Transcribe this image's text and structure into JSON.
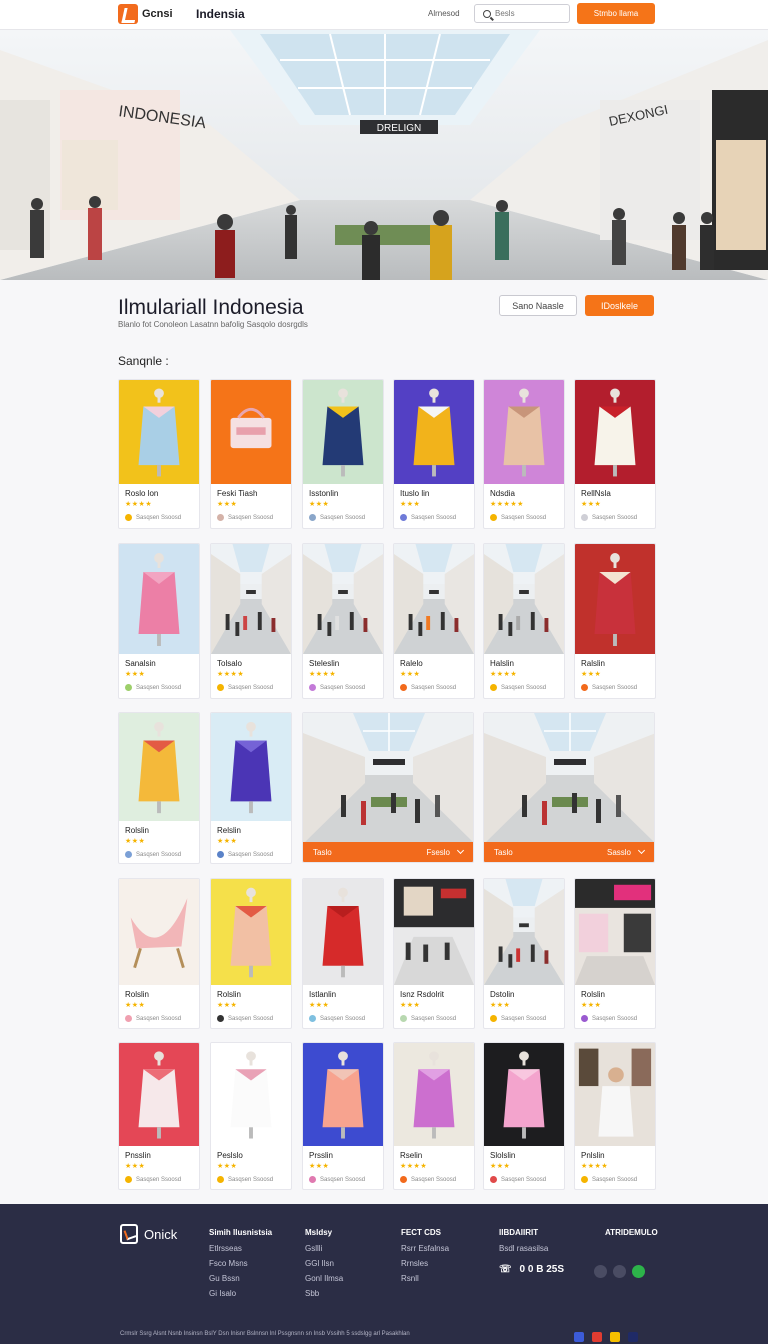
{
  "header": {
    "logo_text": "Gcnsi",
    "site_name": "Indensia",
    "nav_link": "Alrnesod",
    "search_placeholder": "Besls",
    "cta_label": "Stmbo llama"
  },
  "hero": {
    "store_sign_left": "INDONESIA",
    "store_sign_center": "DRELIGN",
    "store_sign_right": "DEXONGI"
  },
  "page": {
    "title": "Ilmulariall Indonesia",
    "subtitle": "Blanlo fot Conoleon Lasatnn bafolig Sasqolo dosrgdls",
    "outline_button": "Sano Naasle",
    "primary_button": "IDoslkele",
    "section_label": "Sanqnle :"
  },
  "products": [
    {
      "name": "Roslo lon",
      "stars": "★★★★",
      "meta": "Sasqsen Ssoosd",
      "photo": "dress-light-blue"
    },
    {
      "name": "Feski Tiash",
      "stars": "★★★",
      "meta": "Sasqsen Ssoosd",
      "photo": "bag-orange"
    },
    {
      "name": "Isstonlin",
      "stars": "★★★",
      "meta": "Sasqsen Ssoosd",
      "photo": "navy-jumpsuit"
    },
    {
      "name": "Ituslo lin",
      "stars": "★★★",
      "meta": "Sasqsen Ssoosd",
      "photo": "yellow-dress"
    },
    {
      "name": "Ndsdia",
      "stars": "★★★★★",
      "meta": "Sasqsen Ssoosd",
      "photo": "patterned-dress"
    },
    {
      "name": "RellNsla",
      "stars": "★★★",
      "meta": "Sasqsen Ssoosd",
      "photo": "red-kebaya"
    },
    {
      "name": "Sanalsin",
      "stars": "★★★",
      "meta": "Sasqsen Ssoosd",
      "photo": "pink-coat"
    },
    {
      "name": "Tolsalo",
      "stars": "★★★★",
      "meta": "Sasqsen Ssoosd",
      "photo": "mall-interior"
    },
    {
      "name": "Steleslin",
      "stars": "★★★★",
      "meta": "Sasqsen Ssoosd",
      "photo": "mall-shoppers"
    },
    {
      "name": "Ralelo",
      "stars": "★★★",
      "meta": "Sasqsen Ssoosd",
      "photo": "mall-corridor"
    },
    {
      "name": "Halslin",
      "stars": "★★★★",
      "meta": "Sasqsen Ssoosd",
      "photo": "mall-atrium"
    },
    {
      "name": "Ralslin",
      "stars": "★★★",
      "meta": "Sasqsen Ssoosd",
      "photo": "red-print-dress"
    },
    {
      "name": "Rolslin",
      "stars": "★★★",
      "meta": "Sasqsen Ssoosd",
      "photo": "yellow-print-shirt"
    },
    {
      "name": "Relslin",
      "stars": "★★★",
      "meta": "Sasqsen Ssoosd",
      "photo": "blue-jumpsuit"
    },
    {
      "name": "Rolslin",
      "stars": "★★★",
      "meta": "Sasqsen Ssoosd",
      "photo": "pink-fabric-stand"
    },
    {
      "name": "Rolslin",
      "stars": "★★★",
      "meta": "Sasqsen Ssoosd",
      "photo": "orange-print-shirt"
    },
    {
      "name": "Istlanlin",
      "stars": "★★★",
      "meta": "Sasqsen Ssoosd",
      "photo": "red-suit"
    },
    {
      "name": "Isnz Rsdolrit",
      "stars": "★★★",
      "meta": "Sasqsen Ssoosd",
      "photo": "mall-storefront"
    },
    {
      "name": "Dstolin",
      "stars": "★★★",
      "meta": "Sasqsen Ssoosd",
      "photo": "mall-walkway"
    },
    {
      "name": "Rolslin",
      "stars": "★★★",
      "meta": "Sasqsen Ssoosd",
      "photo": "fashion-store"
    },
    {
      "name": "Pnsslin",
      "stars": "★★★",
      "meta": "Sasqsen Ssoosd",
      "photo": "floral-dress"
    },
    {
      "name": "Peslslo",
      "stars": "★★★",
      "meta": "Sasqsen Ssoosd",
      "photo": "white-dress"
    },
    {
      "name": "Prsslin",
      "stars": "★★★",
      "meta": "Sasqsen Ssoosd",
      "photo": "peach-dress"
    },
    {
      "name": "Rselin",
      "stars": "★★★★",
      "meta": "Sasqsen Ssoosd",
      "photo": "purple-dress"
    },
    {
      "name": "Slolslin",
      "stars": "★★★",
      "meta": "Sasqsen Ssoosd",
      "photo": "pink-dress-dark"
    },
    {
      "name": "Pnlslin",
      "stars": "★★★★",
      "meta": "Sasqsen Ssoosd",
      "photo": "shopper-woman"
    }
  ],
  "promos": [
    {
      "label": "Taslo",
      "action": "Fseslo"
    },
    {
      "label": "Taslo",
      "action": "Sasslo"
    }
  ],
  "footer": {
    "logo_text": "Onick",
    "columns": [
      {
        "heading": "Simih Ilusnistsia",
        "items": [
          "Etlrsseas",
          "Fsco Msns",
          "Gu Bssn",
          "Gi Isalo"
        ]
      },
      {
        "heading": "Msldsy",
        "items": [
          "Gsllli",
          "GGl Ilsn",
          "Gonl Ilmsa",
          "Sbb"
        ]
      },
      {
        "heading": "FECT CDS",
        "items": [
          "Rsrr Esfalnsa",
          "Rrnsles",
          "Rsnll"
        ]
      },
      {
        "heading": "IIBDAIIRIT",
        "items": [
          "Bsdl rasasilsa"
        ]
      },
      {
        "heading": "ATRIDEMULO",
        "items": []
      }
    ],
    "phone": "0 0 B 25S",
    "copyright": "Crmslr Ssrg Alsnt Nsnb Insinsn BslY Dsn Inisnr Bslnnsn lnl Pssgnsnn sn Insb Vssihh 5 ssdslgg arl Pasakhlan"
  }
}
